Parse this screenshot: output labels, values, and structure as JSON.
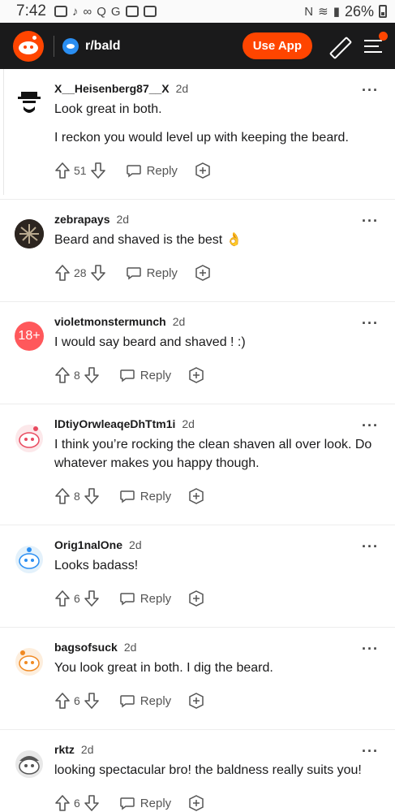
{
  "status_bar": {
    "time": "7:42",
    "battery": "26%"
  },
  "header": {
    "subreddit": "r/bald",
    "use_app_label": "Use App"
  },
  "comments": [
    {
      "user": "X__Heisenberg87__X",
      "time": "2d",
      "paragraphs": [
        "Look great in both.",
        "I reckon you would level up with keeping the beard."
      ],
      "score": "51",
      "reply_label": "Reply",
      "avatar": "heisenberg-avatar"
    },
    {
      "user": "zebrapays",
      "time": "2d",
      "paragraphs": [
        "Beard and shaved is the best 👌"
      ],
      "score": "28",
      "reply_label": "Reply",
      "avatar": "zebra-avatar"
    },
    {
      "user": "violetmonstermunch",
      "time": "2d",
      "paragraphs": [
        "I would say beard and shaved ! :)"
      ],
      "score": "8",
      "reply_label": "Reply",
      "avatar_text": "18+",
      "avatar": "nsfw-avatar"
    },
    {
      "user": "lDtiyOrwleaqeDhTtm1i",
      "time": "2d",
      "paragraphs": [
        "I think you’re rocking the clean shaven all over look. Do whatever makes you happy though."
      ],
      "score": "8",
      "reply_label": "Reply",
      "avatar": "snoo-avatar"
    },
    {
      "user": "Orig1nalOne",
      "time": "2d",
      "paragraphs": [
        "Looks badass!"
      ],
      "score": "6",
      "reply_label": "Reply",
      "avatar": "snoo-avatar"
    },
    {
      "user": "bagsofsuck",
      "time": "2d",
      "paragraphs": [
        "You look great in both. I dig the beard."
      ],
      "score": "6",
      "reply_label": "Reply",
      "avatar": "snoo-avatar"
    },
    {
      "user": "rktz",
      "time": "2d",
      "paragraphs": [
        "looking spectacular bro! the baldness really suits you!"
      ],
      "score": "6",
      "reply_label": "Reply",
      "avatar": "snoo-avatar"
    }
  ],
  "colors": {
    "accent": "#ff4500",
    "header_bg": "#1a1a1b"
  }
}
